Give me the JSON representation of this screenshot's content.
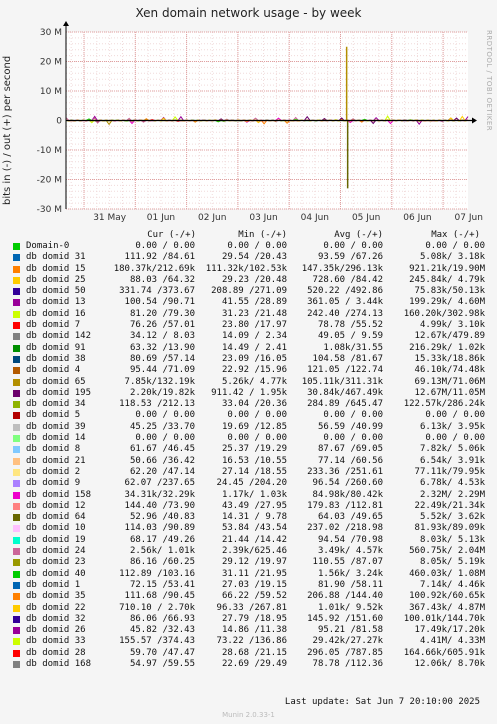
{
  "chart_data": {
    "type": "line",
    "title": "Xen domain network usage - by week",
    "ylabel": "bits in (-) / out (+) per second",
    "ylim": [
      -30000000,
      30000000
    ],
    "yticks": [
      {
        "value": 30000000,
        "label": "30 M"
      },
      {
        "value": 20000000,
        "label": "20 M"
      },
      {
        "value": 10000000,
        "label": "10 M"
      },
      {
        "value": 0,
        "label": "0"
      },
      {
        "value": -10000000,
        "label": "-10 M"
      },
      {
        "value": -20000000,
        "label": "-20 M"
      },
      {
        "value": -30000000,
        "label": "-30 M"
      }
    ],
    "xticks": [
      "31 May",
      "01 Jun",
      "02 Jun",
      "03 Jun",
      "04 Jun",
      "05 Jun",
      "06 Jun",
      "07 Jun"
    ],
    "grid": true,
    "peak": {
      "day": "05 Jun",
      "out": 25000000,
      "in": -23000000
    },
    "legend_header": {
      "cur": "Cur (-/+)",
      "min": "Min (-/+)",
      "avg": "Avg (-/+)",
      "max": "Max (-/+)"
    },
    "series": [
      {
        "name": "Domain-0",
        "color": "#00cc00",
        "cur": "0.00 / 0.00",
        "min": "0.00 / 0.00",
        "avg": "0.00 / 0.00",
        "max": "0.00 / 0.00"
      },
      {
        "name": "db domid 31",
        "color": "#0066b3",
        "cur": "111.92 /84.61",
        "min": "29.54 /20.43",
        "avg": "93.59 /67.26",
        "max": "5.08k/ 3.18k"
      },
      {
        "name": "db domid 15",
        "color": "#ff8000",
        "cur": "180.37k/212.69k",
        "min": "111.32k/102.53k",
        "avg": "147.35k/296.13k",
        "max": "921.21k/19.90M"
      },
      {
        "name": "db domid 25",
        "color": "#ffcc00",
        "cur": "88.03 /64.32",
        "min": "29.23 /20.48",
        "avg": "728.60 /84.42",
        "max": "245.84k/ 4.79k"
      },
      {
        "name": "db domid 50",
        "color": "#330099",
        "cur": "331.74 /373.67",
        "min": "208.89 /271.09",
        "avg": "520.22 /492.86",
        "max": "75.83k/50.13k"
      },
      {
        "name": "db domid 13",
        "color": "#990099",
        "cur": "100.54 /90.71",
        "min": "41.55 /28.89",
        "avg": "361.05 / 3.44k",
        "max": "199.29k/ 4.60M"
      },
      {
        "name": "db domid 16",
        "color": "#ccff00",
        "cur": "81.20 /79.30",
        "min": "31.23 /21.48",
        "avg": "242.40 /274.13",
        "max": "160.20k/302.98k"
      },
      {
        "name": "db domid 7",
        "color": "#ff0000",
        "cur": "76.26 /57.01",
        "min": "23.80 /17.97",
        "avg": "78.78 /55.52",
        "max": "4.99k/ 3.10k"
      },
      {
        "name": "db domid 142",
        "color": "#808080",
        "cur": "34.12 / 8.03",
        "min": "14.09 / 2.34",
        "avg": "49.05 / 9.59",
        "max": "12.67k/479.89"
      },
      {
        "name": "db domid 91",
        "color": "#008f00",
        "cur": "63.32 /13.90",
        "min": "14.49 / 2.41",
        "avg": "1.08k/31.55",
        "max": "216.29k/ 1.02k"
      },
      {
        "name": "db domid 38",
        "color": "#00487d",
        "cur": "80.69 /57.14",
        "min": "23.09 /16.05",
        "avg": "104.58 /81.67",
        "max": "15.33k/18.86k"
      },
      {
        "name": "db domid 4",
        "color": "#b35a00",
        "cur": "95.44 /71.09",
        "min": "22.92 /15.96",
        "avg": "121.05 /122.74",
        "max": "46.10k/74.48k"
      },
      {
        "name": "db domid 65",
        "color": "#b38f00",
        "cur": "7.85k/132.19k",
        "min": "5.26k/ 4.77k",
        "avg": "105.11k/311.31k",
        "max": "69.13M/71.06M"
      },
      {
        "name": "db domid 195",
        "color": "#6b006b",
        "cur": "2.20k/19.82k",
        "min": "911.42 / 1.95k",
        "avg": "30.84k/467.49k",
        "max": "12.67M/11.05M"
      },
      {
        "name": "db domid 34",
        "color": "#8fb300",
        "cur": "118.53 /212.13",
        "min": "33.04 /20.36",
        "avg": "284.89 /645.47",
        "max": "122.57k/286.24k"
      },
      {
        "name": "db domid 5",
        "color": "#b30000",
        "cur": "0.00 / 0.00",
        "min": "0.00 / 0.00",
        "avg": "0.00 / 0.00",
        "max": "0.00 / 0.00"
      },
      {
        "name": "db domid 39",
        "color": "#bebebe",
        "cur": "45.25 /33.70",
        "min": "19.69 /12.85",
        "avg": "56.59 /40.99",
        "max": "6.13k/ 3.95k"
      },
      {
        "name": "db domid 14",
        "color": "#80ff80",
        "cur": "0.00 / 0.00",
        "min": "0.00 / 0.00",
        "avg": "0.00 / 0.00",
        "max": "0.00 / 0.00"
      },
      {
        "name": "db domid 8",
        "color": "#80c9ff",
        "cur": "61.67 /46.45",
        "min": "25.37 /19.29",
        "avg": "87.67 /69.05",
        "max": "7.82k/ 5.06k"
      },
      {
        "name": "db domid 21",
        "color": "#ffc080",
        "cur": "50.66 /36.42",
        "min": "16.53 /10.55",
        "avg": "77.14 /60.56",
        "max": "6.54k/ 3.91k"
      },
      {
        "name": "db domid 2",
        "color": "#ffe680",
        "cur": "62.20 /47.14",
        "min": "27.14 /18.55",
        "avg": "233.36 /251.61",
        "max": "77.11k/79.95k"
      },
      {
        "name": "db domid 9",
        "color": "#aa80ff",
        "cur": "62.07 /237.65",
        "min": "24.45 /204.20",
        "avg": "96.54 /260.60",
        "max": "6.78k/ 4.53k"
      },
      {
        "name": "db domid 158",
        "color": "#ee00cc",
        "cur": "34.31k/32.29k",
        "min": "1.17k/ 1.03k",
        "avg": "84.98k/80.42k",
        "max": "2.32M/ 2.29M"
      },
      {
        "name": "db domid 12",
        "color": "#ff8080",
        "cur": "144.40 /73.90",
        "min": "43.49 /27.95",
        "avg": "179.83 /112.81",
        "max": "22.49k/21.34k"
      },
      {
        "name": "db domid 64",
        "color": "#666600",
        "cur": "52.96 /40.83",
        "min": "14.31 / 9.78",
        "avg": "64.03 /49.65",
        "max": "5.52k/ 3.62k"
      },
      {
        "name": "db domid 10",
        "color": "#ffbfff",
        "cur": "114.03 /90.89",
        "min": "53.84 /43.54",
        "avg": "237.02 /218.98",
        "max": "81.93k/89.09k"
      },
      {
        "name": "db domid 19",
        "color": "#00ffcc",
        "cur": "68.17 /49.26",
        "min": "21.44 /14.42",
        "avg": "94.54 /70.98",
        "max": "8.03k/ 5.13k"
      },
      {
        "name": "db domid 24",
        "color": "#cc6699",
        "cur": "2.56k/ 1.01k",
        "min": "2.39k/625.46",
        "avg": "3.49k/ 4.57k",
        "max": "560.75k/ 2.04M"
      },
      {
        "name": "db domid 23",
        "color": "#999900",
        "cur": "86.16 /60.25",
        "min": "29.12 /19.97",
        "avg": "110.55 /87.07",
        "max": "8.05k/ 5.19k"
      },
      {
        "name": "db domid 40",
        "color": "#00cc00",
        "cur": "112.89 /103.16",
        "min": "31.11 /21.95",
        "avg": "1.56k/ 3.24k",
        "max": "460.03k/ 1.08M"
      },
      {
        "name": "db domid 1",
        "color": "#0066b3",
        "cur": "72.15 /53.41",
        "min": "27.03 /19.15",
        "avg": "81.90 /58.11",
        "max": "7.14k/ 4.46k"
      },
      {
        "name": "db domid 35",
        "color": "#ff8000",
        "cur": "111.68 /90.45",
        "min": "66.22 /59.52",
        "avg": "206.88 /144.40",
        "max": "100.92k/60.65k"
      },
      {
        "name": "db domid 22",
        "color": "#ffcc00",
        "cur": "710.10 / 2.70k",
        "min": "96.33 /267.81",
        "avg": "1.01k/ 9.52k",
        "max": "367.43k/ 4.87M"
      },
      {
        "name": "db domid 32",
        "color": "#330099",
        "cur": "86.06 /66.93",
        "min": "27.79 /18.95",
        "avg": "145.92 /151.60",
        "max": "100.01k/144.70k"
      },
      {
        "name": "db domid 26",
        "color": "#990099",
        "cur": "45.82 /32.43",
        "min": "14.86 /11.38",
        "avg": "95.21 /81.58",
        "max": "17.49k/17.20k"
      },
      {
        "name": "db domid 33",
        "color": "#ccff00",
        "cur": "155.57 /374.43",
        "min": "73.22 /136.86",
        "avg": "29.42k/27.27k",
        "max": "4.41M/ 4.33M"
      },
      {
        "name": "db domid 28",
        "color": "#ff0000",
        "cur": "59.70 /47.47",
        "min": "28.68 /21.15",
        "avg": "296.05 /787.85",
        "max": "164.66k/605.91k"
      },
      {
        "name": "db domid 168",
        "color": "#808080",
        "cur": "54.97 /59.55",
        "min": "22.69 /29.49",
        "avg": "78.78 /112.36",
        "max": "12.06k/ 8.70k"
      }
    ]
  },
  "side_label": "RRDTOOL / TOBI OETIKER",
  "footer": "Last update:  Sat Jun  7 20:10:00 2025",
  "munin_version": "Munin 2.0.33-1"
}
